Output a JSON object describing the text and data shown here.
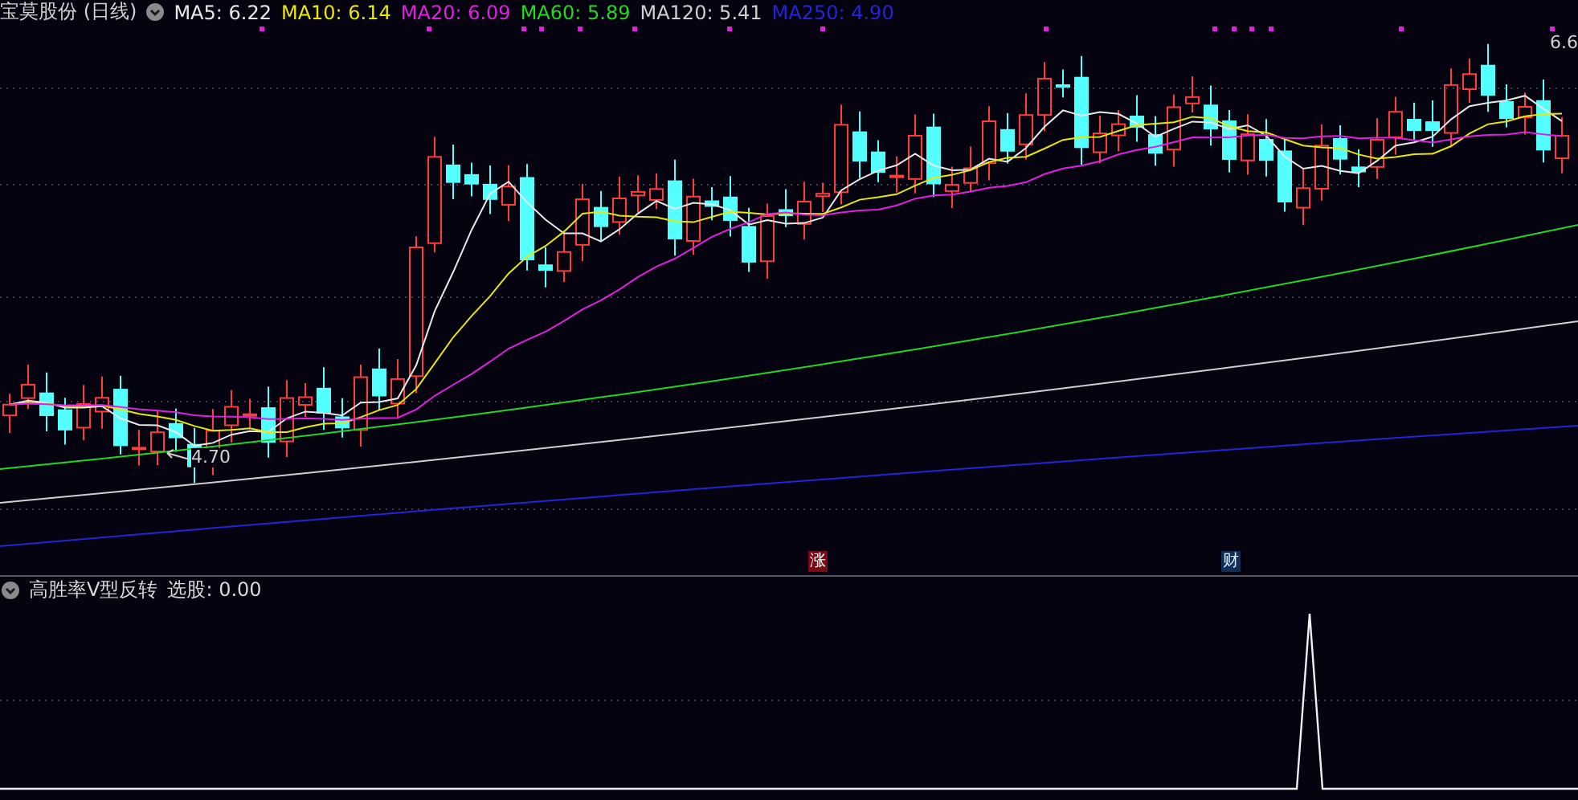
{
  "main_panel": {
    "legend": {
      "stock_name": "宝莫股份",
      "period": "(日线)",
      "averages": [
        {
          "label": "MA5:",
          "value": "6.22",
          "color": "#e8e8e8"
        },
        {
          "label": "MA10:",
          "value": "6.14",
          "color": "#e8e800"
        },
        {
          "label": "MA20:",
          "value": "6.09",
          "color": "#e020e0"
        },
        {
          "label": "MA60:",
          "value": "5.89",
          "color": "#22d822"
        },
        {
          "label": "MA120:",
          "value": "5.41",
          "color": "#cfcfcf"
        },
        {
          "label": "MA250:",
          "value": "4.90",
          "color": "#2424d8"
        }
      ]
    },
    "price_label": "6.6",
    "low_label": "4.70",
    "events": [
      {
        "text": "涨",
        "kind": "rise"
      },
      {
        "text": "财",
        "kind": "finance"
      }
    ]
  },
  "indicator_panel": {
    "name": "高胜率V型反转",
    "output_label": "选股:",
    "output_value": "0.00"
  }
}
